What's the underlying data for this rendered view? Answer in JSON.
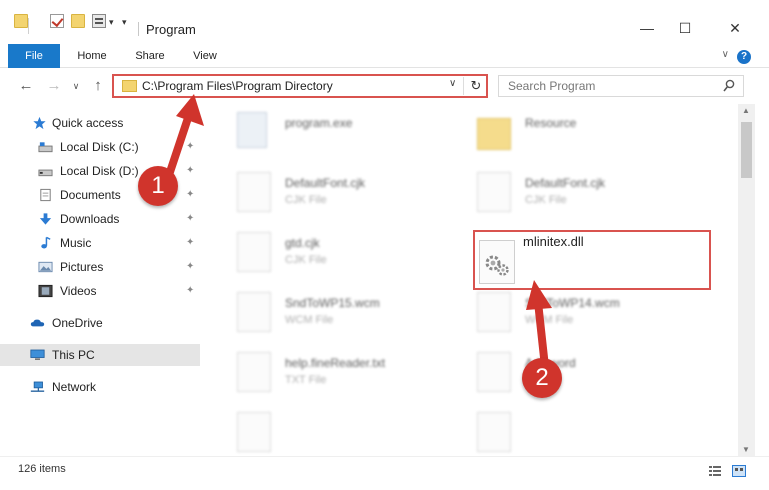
{
  "window": {
    "title": "Program",
    "minimize": "—",
    "maximize": "☐",
    "close": "✕"
  },
  "ribbon": {
    "tabs": [
      "File",
      "Home",
      "Share",
      "View"
    ],
    "help": "?",
    "collapse": "∨"
  },
  "address": {
    "path": "C:\\Program Files\\Program Directory",
    "dropdown": "∨",
    "refresh": "↻"
  },
  "search": {
    "placeholder": "Search Program"
  },
  "nav": {
    "back": "←",
    "forward": "→",
    "recent": "∨",
    "up": "↑"
  },
  "navpane": {
    "quick_access": "Quick access",
    "local_c": "Local Disk (C:)",
    "local_d": "Local Disk (D:)",
    "documents": "Documents",
    "downloads": "Downloads",
    "music": "Music",
    "pictures": "Pictures",
    "videos": "Videos",
    "onedrive": "OneDrive",
    "this_pc": "This PC",
    "network": "Network",
    "pin": "📌"
  },
  "files": [
    {
      "name": "program.exe",
      "type": ""
    },
    {
      "name": "Resource",
      "type": ""
    },
    {
      "name": "DefaultFont.cjk",
      "type": "CJK File"
    },
    {
      "name": "DefaultFont.cjk",
      "type": "CJK File"
    },
    {
      "name": "gtd.cjk",
      "type": "CJK File"
    },
    {
      "name": "SndToWP15.wcm",
      "type": "WCM File"
    },
    {
      "name": "SndToWP14.wcm",
      "type": "WCM File"
    },
    {
      "name": "help.fineReader.txt",
      "type": "TXT File"
    },
    {
      "name": "Ad...word",
      "type": ""
    }
  ],
  "highlighted_file": {
    "name": "mlinitex.dll"
  },
  "callouts": {
    "step1": "1",
    "step2": "2"
  },
  "status": {
    "items": "126 items"
  },
  "colors": {
    "accent": "#1979ca",
    "callout": "#d0342c",
    "highlight_border": "#d9534f"
  }
}
